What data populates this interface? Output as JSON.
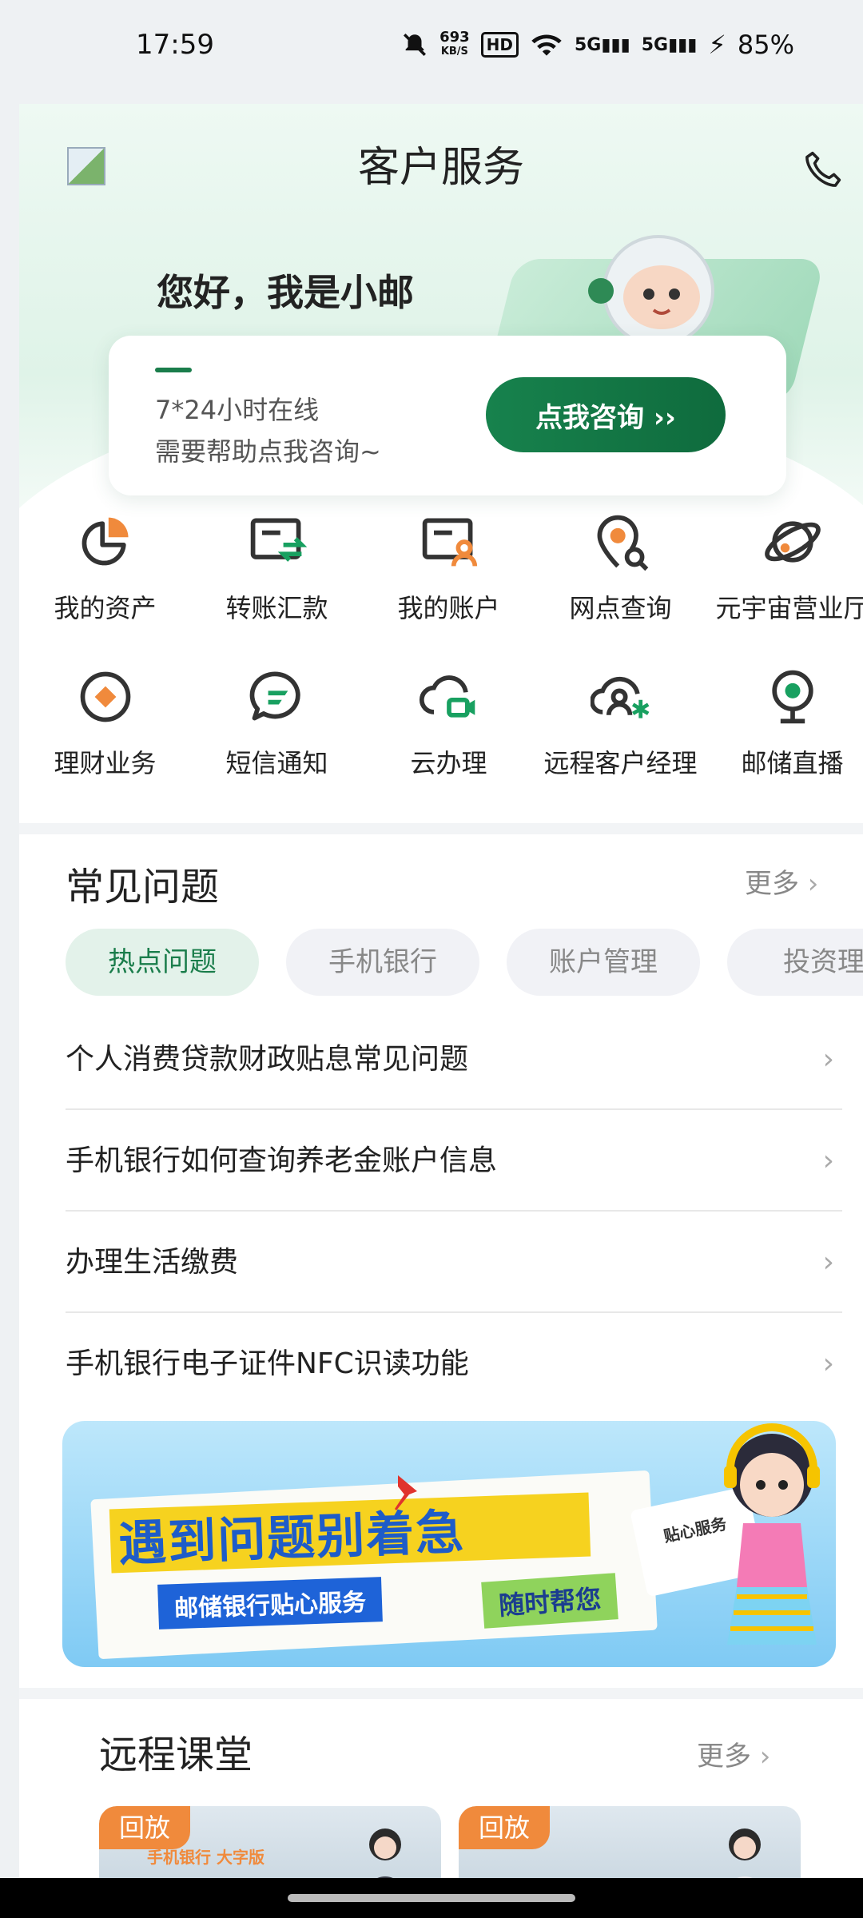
{
  "status_bar": {
    "time": "17:59",
    "net_speed_value": "693",
    "net_speed_unit": "KB/S",
    "hd_label": "HD",
    "signal1_label": "5G",
    "signal2_label": "5G",
    "battery": "85%"
  },
  "header": {
    "title": "客户服务"
  },
  "hero": {
    "greeting": "您好，我是小邮",
    "line1": "7*24小时在线",
    "line2": "需要帮助点我咨询~",
    "button": "点我咨询 ››"
  },
  "services": [
    {
      "label": "我的资产",
      "icon": "pie-chart-icon"
    },
    {
      "label": "转账汇款",
      "icon": "transfer-icon"
    },
    {
      "label": "我的账户",
      "icon": "account-card-icon"
    },
    {
      "label": "网点查询",
      "icon": "location-search-icon"
    },
    {
      "label": "元宇宙营业厅",
      "icon": "planet-icon"
    },
    {
      "label": "理财业务",
      "icon": "finance-icon"
    },
    {
      "label": "短信通知",
      "icon": "sms-icon"
    },
    {
      "label": "云办理",
      "icon": "cloud-video-icon"
    },
    {
      "label": "远程客户经理",
      "icon": "remote-manager-icon"
    },
    {
      "label": "邮储直播",
      "icon": "live-camera-icon"
    }
  ],
  "faq": {
    "title": "常见问题",
    "more": "更多",
    "tabs": [
      "热点问题",
      "手机银行",
      "账户管理",
      "投资理"
    ],
    "items": [
      "个人消费贷款财政贴息常见问题",
      "手机银行如何查询养老金账户信息",
      "办理生活缴费",
      "手机银行电子证件NFC识读功能"
    ]
  },
  "banner": {
    "main": "遇到问题别着急",
    "sub1": "邮储银行贴心服务",
    "sub2": "随时帮您",
    "envelope": "贴心服务"
  },
  "courses": {
    "title": "远程课堂",
    "more": "更多",
    "cards": [
      {
        "tag": "回放",
        "text": "手机银行 大字版"
      },
      {
        "tag": "回放",
        "text": ""
      }
    ]
  },
  "colors": {
    "brand_green": "#1a7d4b",
    "accent_orange": "#f08a3c",
    "icon_green": "#18a060"
  }
}
